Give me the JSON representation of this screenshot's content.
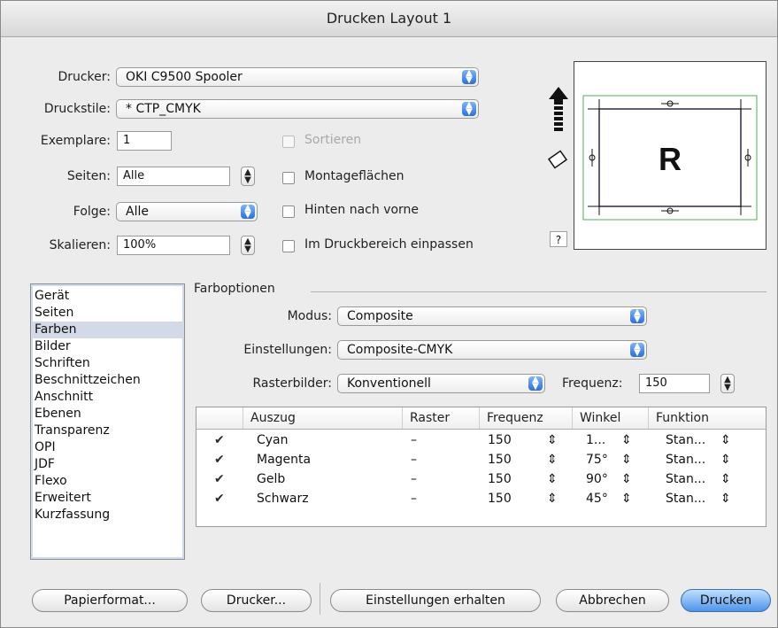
{
  "window": {
    "title": "Drucken Layout 1"
  },
  "form": {
    "printer_label": "Drucker:",
    "printer_value": "OKI C9500 Spooler",
    "style_label": "Druckstile:",
    "style_value": "* CTP_CMYK",
    "copies_label": "Exemplare:",
    "copies_value": "1",
    "pages_label": "Seiten:",
    "pages_value": "Alle",
    "sequence_label": "Folge:",
    "sequence_value": "Alle",
    "scale_label": "Skalieren:",
    "scale_value": "100%"
  },
  "checkboxes": {
    "sortieren": "Sortieren",
    "montage": "Montageflächen",
    "hinten": "Hinten nach vorne",
    "einpassen": "Im Druckbereich einpassen"
  },
  "preview": {
    "letter": "R",
    "help": "?"
  },
  "categories": [
    "Gerät",
    "Seiten",
    "Farben",
    "Bilder",
    "Schriften",
    "Beschnittzeichen",
    "Anschnitt",
    "Ebenen",
    "Transparenz",
    "OPI",
    "JDF",
    "Flexo",
    "Erweitert",
    "Kurzfassung"
  ],
  "farb": {
    "group_title": "Farboptionen",
    "mode_label": "Modus:",
    "mode_value": "Composite",
    "settings_label": "Einstellungen:",
    "settings_value": "Composite-CMYK",
    "raster_label": "Rasterbilder:",
    "raster_value": "Konventionell",
    "freq_label": "Frequenz:",
    "freq_value": "150"
  },
  "table": {
    "headers": [
      "Auszug",
      "Raster",
      "Frequenz",
      "Winkel",
      "Funktion"
    ],
    "rows": [
      {
        "auszug": "Cyan",
        "raster": "–",
        "frequenz": "150",
        "winkel": "1...",
        "funktion": "Stan..."
      },
      {
        "auszug": "Magenta",
        "raster": "–",
        "frequenz": "150",
        "winkel": "75°",
        "funktion": "Stan..."
      },
      {
        "auszug": "Gelb",
        "raster": "–",
        "frequenz": "150",
        "winkel": "90°",
        "funktion": "Stan..."
      },
      {
        "auszug": "Schwarz",
        "raster": "–",
        "frequenz": "150",
        "winkel": "45°",
        "funktion": "Stan..."
      }
    ]
  },
  "buttons": {
    "papierformat": "Papierformat...",
    "drucker": "Drucker...",
    "einstellungen": "Einstellungen erhalten",
    "abbrechen": "Abbrechen",
    "drucken": "Drucken"
  }
}
